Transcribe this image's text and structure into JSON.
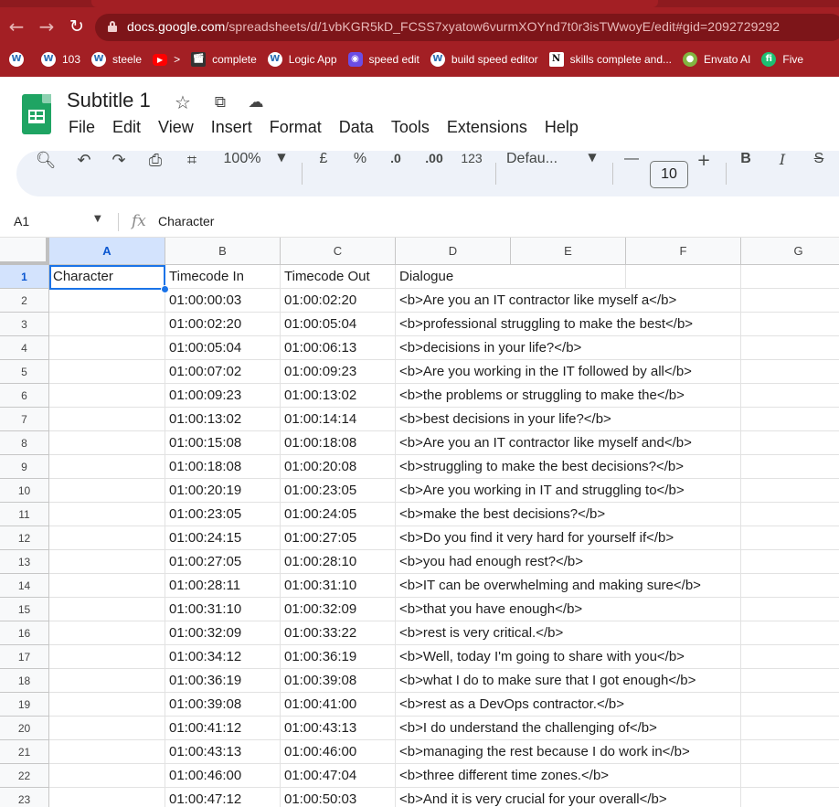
{
  "browser": {
    "url_host": "docs.google.com",
    "url_rest": "/spreadsheets/d/1vbKGR5kD_FCSS7xyatow6vurmXOYnd7t0r3isTWwoyE/edit#gid=2092729292",
    "bookmarks": [
      {
        "label": "",
        "icon": "wordpress-icon"
      },
      {
        "label": "103",
        "icon": "wordpress-icon"
      },
      {
        "label": "steele",
        "icon": "wordpress-icon"
      },
      {
        "label": ">",
        "icon": "youtube-icon"
      },
      {
        "label": "complete",
        "icon": "clapperboard-icon"
      },
      {
        "label": "Logic App",
        "icon": "wordpress-icon"
      },
      {
        "label": "speed edit",
        "icon": "camera-icon"
      },
      {
        "label": "build speed editor",
        "icon": "wordpress-icon"
      },
      {
        "label": "skills complete and...",
        "icon": "notion-icon"
      },
      {
        "label": "Envato AI",
        "icon": "envato-icon"
      },
      {
        "label": "Five",
        "icon": "fiverr-icon"
      }
    ]
  },
  "doc": {
    "title": "Subtitle 1",
    "menu": [
      "File",
      "Edit",
      "View",
      "Insert",
      "Format",
      "Data",
      "Tools",
      "Extensions",
      "Help"
    ]
  },
  "toolbar": {
    "zoom": "100%",
    "currency": "£",
    "percent": "%",
    "dec_decrease": ".0",
    "dec_increase": ".00",
    "number_format": "123",
    "font": "Defau...",
    "font_size": "10",
    "minus": "—",
    "plus": "+",
    "bold": "B",
    "italic": "I",
    "strike": "S"
  },
  "formula_bar": {
    "cell_ref": "A1",
    "fx": "fx",
    "content": "Character"
  },
  "grid": {
    "columns": [
      "A",
      "B",
      "C",
      "D",
      "E",
      "F",
      "G"
    ],
    "selected_column": "A",
    "selected_row": "1",
    "rows": [
      {
        "num": "1",
        "a": "Character",
        "b": "Timecode In",
        "c": "Timecode Out",
        "d": "Dialogue"
      },
      {
        "num": "2",
        "a": "",
        "b": "01:00:00:03",
        "c": "01:00:02:20",
        "d": "<b>Are you an IT contractor like myself a</b>"
      },
      {
        "num": "3",
        "a": "",
        "b": "01:00:02:20",
        "c": "01:00:05:04",
        "d": "<b>professional struggling to make the best</b>"
      },
      {
        "num": "4",
        "a": "",
        "b": "01:00:05:04",
        "c": "01:00:06:13",
        "d": "<b>decisions in your life?</b>"
      },
      {
        "num": "5",
        "a": "",
        "b": "01:00:07:02",
        "c": "01:00:09:23",
        "d": "<b>Are you working in the IT followed by all</b>"
      },
      {
        "num": "6",
        "a": "",
        "b": "01:00:09:23",
        "c": "01:00:13:02",
        "d": "<b>the problems or struggling to make the</b>"
      },
      {
        "num": "7",
        "a": "",
        "b": "01:00:13:02",
        "c": "01:00:14:14",
        "d": "<b>best decisions in your life?</b>"
      },
      {
        "num": "8",
        "a": "",
        "b": "01:00:15:08",
        "c": "01:00:18:08",
        "d": "<b>Are you an IT contractor like myself and</b>"
      },
      {
        "num": "9",
        "a": "",
        "b": "01:00:18:08",
        "c": "01:00:20:08",
        "d": "<b>struggling to make the best decisions?</b>"
      },
      {
        "num": "10",
        "a": "",
        "b": "01:00:20:19",
        "c": "01:00:23:05",
        "d": "<b>Are you working in IT and struggling to</b>"
      },
      {
        "num": "11",
        "a": "",
        "b": "01:00:23:05",
        "c": "01:00:24:05",
        "d": "<b>make the best decisions?</b>"
      },
      {
        "num": "12",
        "a": "",
        "b": "01:00:24:15",
        "c": "01:00:27:05",
        "d": "<b>Do you find it very hard for yourself if</b>"
      },
      {
        "num": "13",
        "a": "",
        "b": "01:00:27:05",
        "c": "01:00:28:10",
        "d": "<b>you had enough rest?</b>"
      },
      {
        "num": "14",
        "a": "",
        "b": "01:00:28:11",
        "c": "01:00:31:10",
        "d": "<b>IT can be overwhelming and making sure</b>"
      },
      {
        "num": "15",
        "a": "",
        "b": "01:00:31:10",
        "c": "01:00:32:09",
        "d": "<b>that you have enough</b>"
      },
      {
        "num": "16",
        "a": "",
        "b": "01:00:32:09",
        "c": "01:00:33:22",
        "d": "<b>rest is very critical.</b>"
      },
      {
        "num": "17",
        "a": "",
        "b": "01:00:34:12",
        "c": "01:00:36:19",
        "d": "<b>Well, today I'm going to share with you</b>"
      },
      {
        "num": "18",
        "a": "",
        "b": "01:00:36:19",
        "c": "01:00:39:08",
        "d": "<b>what I do to make sure that I got enough</b>"
      },
      {
        "num": "19",
        "a": "",
        "b": "01:00:39:08",
        "c": "01:00:41:00",
        "d": "<b>rest as a DevOps contractor.</b>"
      },
      {
        "num": "20",
        "a": "",
        "b": "01:00:41:12",
        "c": "01:00:43:13",
        "d": "<b>I do understand the challenging of</b>"
      },
      {
        "num": "21",
        "a": "",
        "b": "01:00:43:13",
        "c": "01:00:46:00",
        "d": "<b>managing the rest because I do work in</b>"
      },
      {
        "num": "22",
        "a": "",
        "b": "01:00:46:00",
        "c": "01:00:47:04",
        "d": "<b>three different time zones.</b>"
      },
      {
        "num": "23",
        "a": "",
        "b": "01:00:47:12",
        "c": "01:00:50:03",
        "d": "<b>And it is very crucial for your overall</b>"
      }
    ]
  },
  "colors": {
    "browser_frame": "#a31f24",
    "selection": "#1a73e8",
    "sheets_green": "#1fa463",
    "toolbar_bg": "#eef2f9"
  }
}
